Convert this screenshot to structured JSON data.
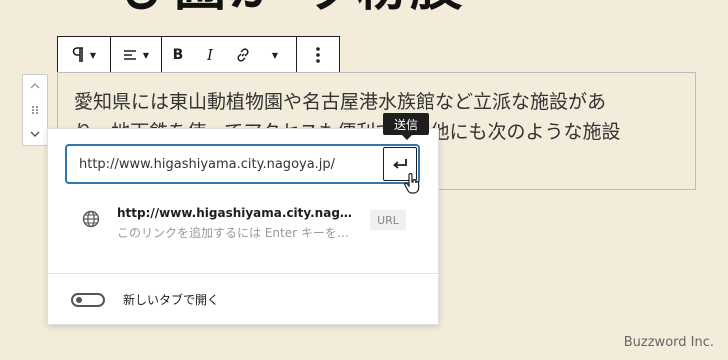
{
  "heading": {
    "fragment": "ぴ圃か ッ粉肢"
  },
  "paragraph": {
    "line1": "愛知県には東山動植物園や名古屋港水族館など立派な施設があ",
    "line2": "り、地下鉄を使ってアクセスも便利です。他にも次のような施設"
  },
  "toolbar": {
    "paragraph_icon": "pilcrow-icon",
    "align_icon": "align-left-icon",
    "bold_label": "B",
    "italic_label": "I",
    "link_icon": "link-icon",
    "more_icon": "more-vertical-icon"
  },
  "tooltip": {
    "label": "送信"
  },
  "link_popover": {
    "url_value": "http://www.higashiyama.city.nagoya.jp/",
    "suggestion": {
      "title": "http://www.higashiyama.city.nagoya.jp/",
      "subtitle": "このリンクを追加するには Enter キーを押してください",
      "badge": "URL"
    },
    "new_tab_label": "新しいタブで開く",
    "new_tab_enabled": false
  },
  "footer": {
    "brand": "Buzzword Inc."
  },
  "colors": {
    "accent": "#2f78ad",
    "background": "#f3ecdb",
    "tooltip_bg": "#1e1e1e"
  }
}
